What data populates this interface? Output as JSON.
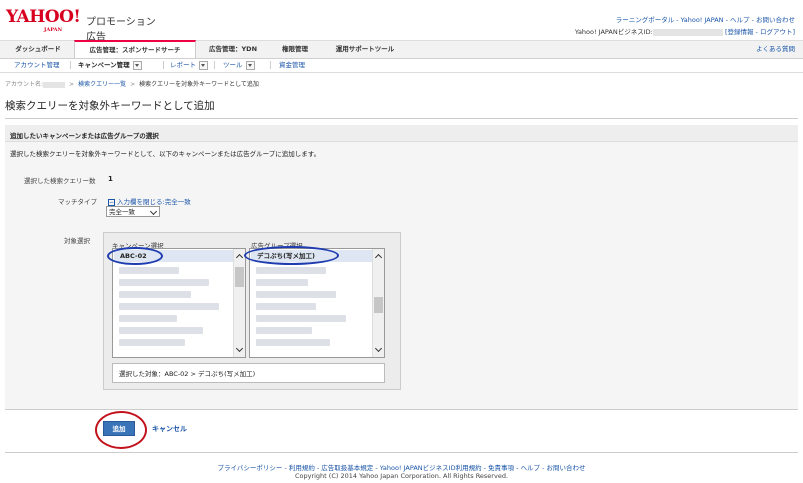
{
  "header": {
    "logo_text": "YAHOO!",
    "logo_sub": "JAPAN",
    "product": "プロモーション広告",
    "links_row1": "ラーニングポータル - Yahoo! JAPAN - ヘルプ - お問い合わせ",
    "business_id_label": "Yahoo! JAPANビジネスID:",
    "links_row2": "[登録情報 - ログアウト]"
  },
  "tabs": [
    {
      "label": "ダッシュボード"
    },
    {
      "label": "広告管理：スポンサードサーチ"
    },
    {
      "label": "広告管理：YDN"
    },
    {
      "label": "権限管理"
    },
    {
      "label": "運用サポートツール"
    }
  ],
  "help_link": "よくある質問",
  "subnav": {
    "account": "アカウント管理",
    "campaign": "キャンペーン管理",
    "report": "レポート",
    "tool": "ツール",
    "funds": "資金管理"
  },
  "breadcrumb": {
    "account_label": "アカウント名:",
    "query_list": "検索クエリー一覧",
    "current": "検索クエリーを対象外キーワードとして追加"
  },
  "page_title": "検索クエリーを対象外キーワードとして追加",
  "section": {
    "title": "追加したいキャンペーンまたは広告グループの選択",
    "description": "選択した検索クエリーを対象外キーワードとして、以下のキャンペーンまたは広告グループに追加します。"
  },
  "form": {
    "query_count_label": "選択した検索クエリー数",
    "query_count": "1",
    "match_type_label": "マッチタイプ",
    "match_toggle_icon": "−",
    "match_toggle": "入力欄を閉じる:完全一致",
    "match_selected": "完全一致",
    "target_label": "対象選択",
    "campaign_header": "キャンペーン選択",
    "adgroup_header": "広告グループ選択",
    "campaign_selected": "ABC-02",
    "adgroup_selected": "デコぷち(写メ加工)",
    "chosen_summary": "選択した対象：ABC-02 > デコぷち(写メ加工)"
  },
  "actions": {
    "add": "追加",
    "cancel": "キャンセル"
  },
  "footer": {
    "links": "プライバシーポリシー - 利用規約 - 広告取扱基本規定 - Yahoo! JAPANビジネスID利用規約 - 免責事項 - ヘルプ - お問い合わせ",
    "copyright": "Copyright (C) 2014 Yahoo Japan Corporation. All Rights Reserved."
  },
  "colors": {
    "brand_red": "#d8001f",
    "link_blue": "#1a55a8",
    "button_blue": "#3a74b8",
    "annotation_blue": "#1e3cb0",
    "annotation_red": "#c2121c"
  }
}
